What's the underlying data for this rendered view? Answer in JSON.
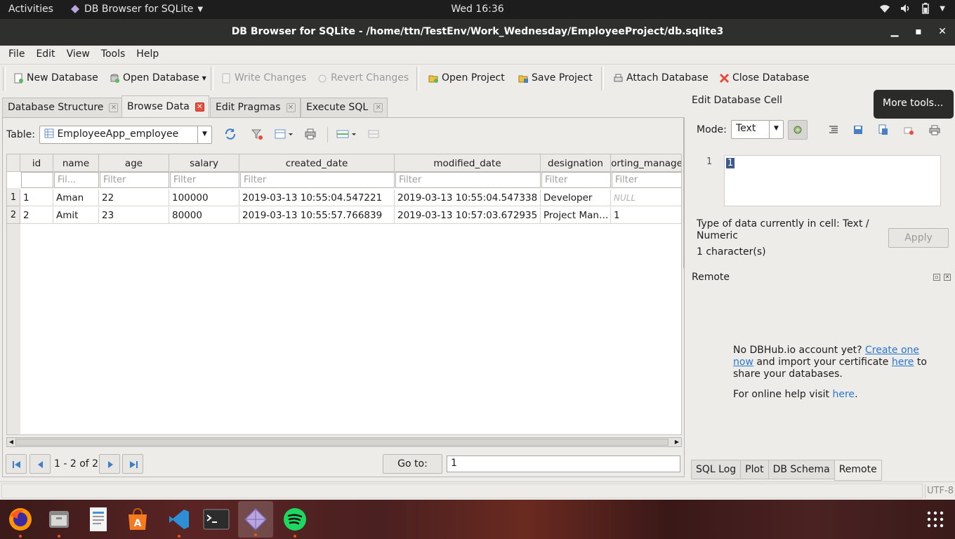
{
  "topbar": {
    "activities": "Activities",
    "app_name": "DB Browser for SQLite",
    "clock": "Wed 16:36"
  },
  "window": {
    "title": "DB Browser for SQLite - /home/ttn/TestEnv/Work_Wednesday/EmployeeProject/db.sqlite3"
  },
  "menu": [
    "File",
    "Edit",
    "View",
    "Tools",
    "Help"
  ],
  "toolbar": {
    "new_database": "New Database",
    "open_database": "Open Database",
    "write_changes": "Write Changes",
    "revert_changes": "Revert Changes",
    "open_project": "Open Project",
    "save_project": "Save Project",
    "attach_database": "Attach Database",
    "close_database": "Close Database"
  },
  "tabs": [
    "Database Structure",
    "Browse Data",
    "Edit Pragmas",
    "Execute SQL"
  ],
  "active_tab": "Browse Data",
  "browse": {
    "table_label": "Table:",
    "table_name": "EmployeeApp_employee",
    "columns": [
      "id",
      "name",
      "age",
      "salary",
      "created_date",
      "modified_date",
      "designation",
      "orting_manage"
    ],
    "filters": [
      "",
      "Fil...",
      "Filter",
      "Filter",
      "Filter",
      "Filter",
      "Filter",
      "Filter"
    ],
    "rows": [
      [
        "1",
        "Aman",
        "22",
        "100000",
        "2019-03-13 10:55:04.547221",
        "2019-03-13 10:55:04.547338",
        "Developer",
        "NULL"
      ],
      [
        "2",
        "Amit",
        "23",
        "80000",
        "2019-03-13 10:55:57.766839",
        "2019-03-13 10:57:03.672935",
        "Project Man…",
        "1"
      ]
    ],
    "row_numbers": [
      "1",
      "2"
    ],
    "record_count": "1 - 2 of 2",
    "goto_label": "Go to:",
    "goto_value": "1"
  },
  "edit_cell": {
    "title": "Edit Database Cell",
    "mode_label": "Mode:",
    "mode_value": "Text",
    "line_number": "1",
    "cell_value": "1",
    "type_info": "Type of data currently in cell: Text / Numeric",
    "size_info": "1 character(s)",
    "apply": "Apply"
  },
  "tooltip": "More tools...",
  "remote": {
    "title": "Remote",
    "text1": "No DBHub.io account yet?",
    "link1": "Create one now",
    "text2": "and import your certificate",
    "link2": "here",
    "text3": "to share your databases.",
    "text4": "For online help visit",
    "link3": "here",
    "text5": "."
  },
  "bottom_tabs": [
    "SQL Log",
    "Plot",
    "DB Schema",
    "Remote"
  ],
  "active_bottom_tab": "Remote",
  "statusbar": {
    "encoding": "UTF-8"
  },
  "dock_apps": [
    "firefox-icon",
    "files-icon",
    "text-editor-icon",
    "software-center-icon",
    "vscode-icon",
    "terminal-icon",
    "sqlite-browser-icon",
    "spotify-icon",
    "app-grid-icon"
  ],
  "colors": {
    "accent_link": "#2a76d0",
    "close_red": "#e74c3c",
    "selection": "#3d5a8a"
  }
}
